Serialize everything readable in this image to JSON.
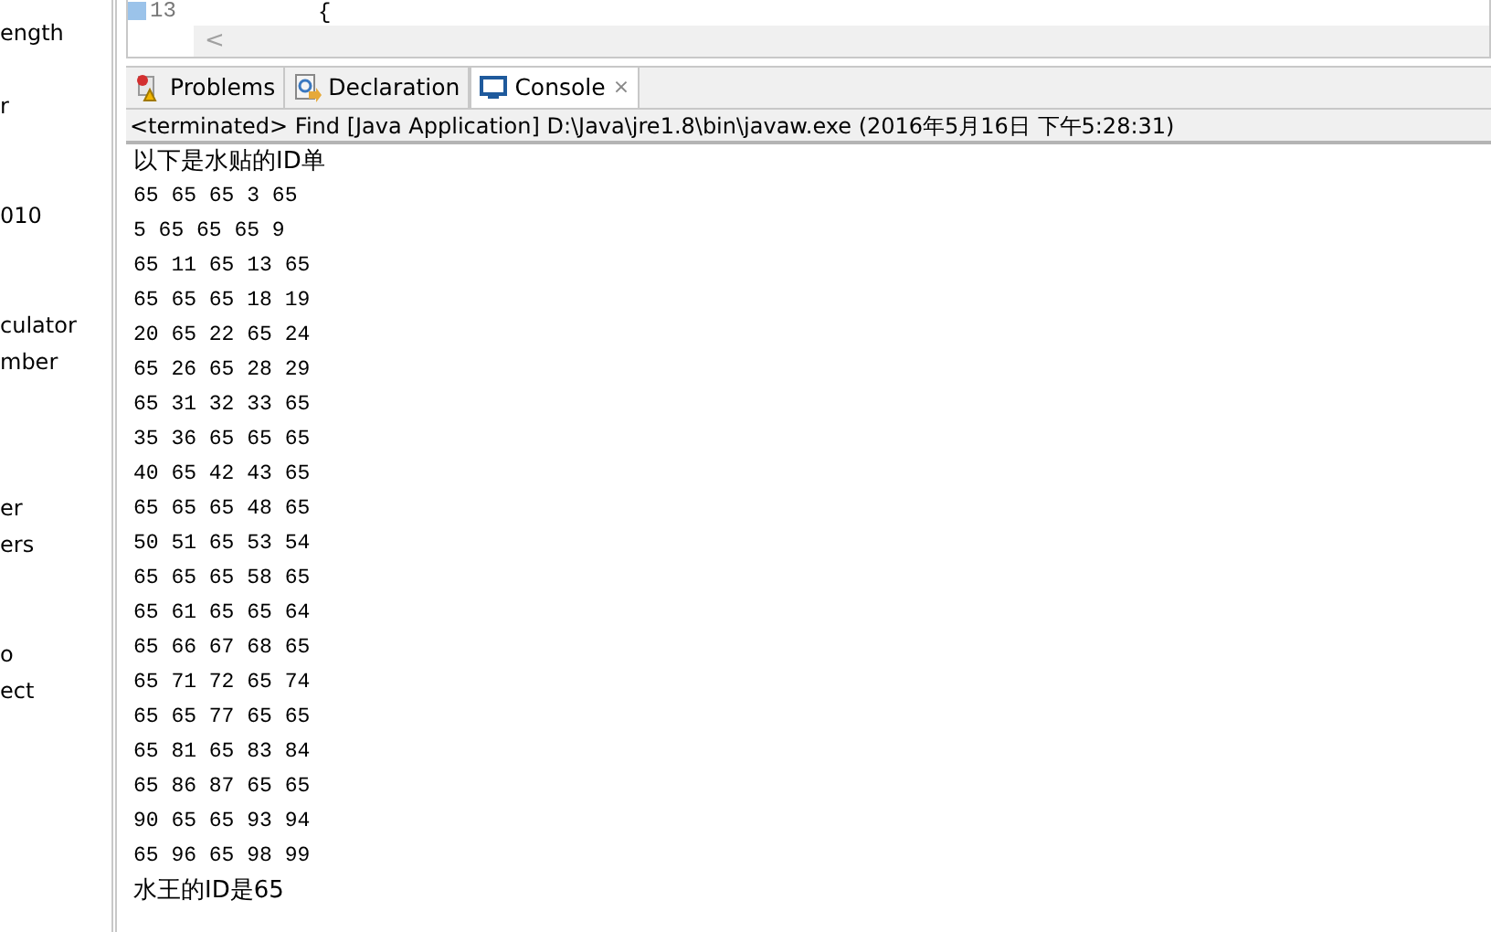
{
  "sidebar": {
    "items": [
      "ength",
      "r",
      "010",
      "culator",
      "mber",
      "er",
      "ers",
      "o",
      "ect"
    ]
  },
  "editor": {
    "line_number": "13",
    "code_line": "{",
    "scroll_arrow": "<"
  },
  "tabs": [
    {
      "label": "Problems",
      "selected": false
    },
    {
      "label": "Declaration",
      "selected": false
    },
    {
      "label": "Console",
      "selected": true,
      "close": "⨯"
    }
  ],
  "console": {
    "header": "<terminated> Find [Java Application] D:\\Java\\jre1.8\\bin\\javaw.exe (2016年5月16日 下午5:28:31)",
    "lines": [
      "以下是水贴的ID单",
      "65 65 65 3 65",
      "5 65 65 65 9",
      "65 11 65 13 65",
      "65 65 65 18 19",
      "20 65 22 65 24",
      "65 26 65 28 29",
      "65 31 32 33 65",
      "35 36 65 65 65",
      "40 65 42 43 65",
      "65 65 65 48 65",
      "50 51 65 53 54",
      "65 65 65 58 65",
      "65 61 65 65 64",
      "65 66 67 68 65",
      "65 71 72 65 74",
      "65 65 77 65 65",
      "65 81 65 83 84",
      "65 86 87 65 65",
      "90 65 65 93 94",
      "65 96 65 98 99",
      "水王的ID是65"
    ]
  }
}
